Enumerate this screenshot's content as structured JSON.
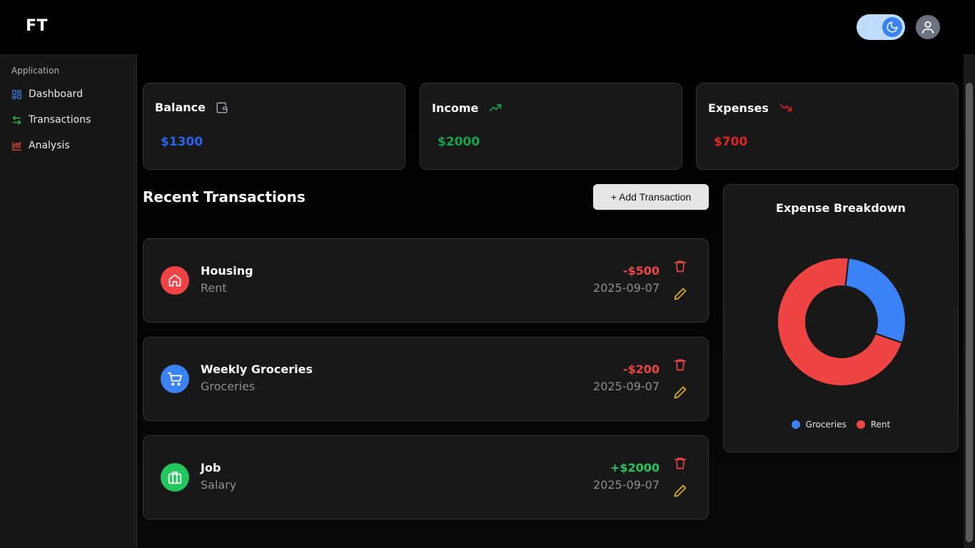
{
  "app": {
    "logo": "FT"
  },
  "header": {
    "theme_toggle_icon": "moon-icon",
    "avatar_icon": "user-icon"
  },
  "sidebar": {
    "section_label": "Application",
    "items": [
      {
        "label": "Dashboard",
        "icon": "dashboard-grid-icon",
        "color": "#3b82f6"
      },
      {
        "label": "Transactions",
        "icon": "arrows-left-right-icon",
        "color": "#22c55e"
      },
      {
        "label": "Analysis",
        "icon": "chart-line-icon",
        "color": "#ef4444"
      }
    ]
  },
  "stats": [
    {
      "title": "Balance",
      "value": "$1300",
      "icon": "wallet-icon",
      "color": "#2563eb"
    },
    {
      "title": "Income",
      "value": "$2000",
      "icon": "trending-up-icon",
      "color": "#16a34a"
    },
    {
      "title": "Expenses",
      "value": "$700",
      "icon": "trending-down-icon",
      "color": "#dc2626"
    }
  ],
  "transactions_section": {
    "title": "Recent Transactions",
    "add_button": "+ Add Transaction",
    "items": [
      {
        "title": "Housing",
        "category": "Rent",
        "amount": "-$500",
        "date": "2025-09-07",
        "icon": "home-icon",
        "icon_bg": "#ef4444",
        "amount_color": "#ef4444"
      },
      {
        "title": "Weekly Groceries",
        "category": "Groceries",
        "amount": "-$200",
        "date": "2025-09-07",
        "icon": "shopping-cart-icon",
        "icon_bg": "#3b82f6",
        "amount_color": "#ef4444"
      },
      {
        "title": "Job",
        "category": "Salary",
        "amount": "+$2000",
        "date": "2025-09-07",
        "icon": "briefcase-icon",
        "icon_bg": "#22c55e",
        "amount_color": "#22c55e"
      }
    ]
  },
  "chart_data": {
    "type": "pie",
    "title": "Expense Breakdown",
    "categories": [
      "Groceries",
      "Rent"
    ],
    "values": [
      200,
      500
    ],
    "colors": [
      "#3b82f6",
      "#ef4444"
    ],
    "donut": true,
    "legend": "bottom"
  }
}
